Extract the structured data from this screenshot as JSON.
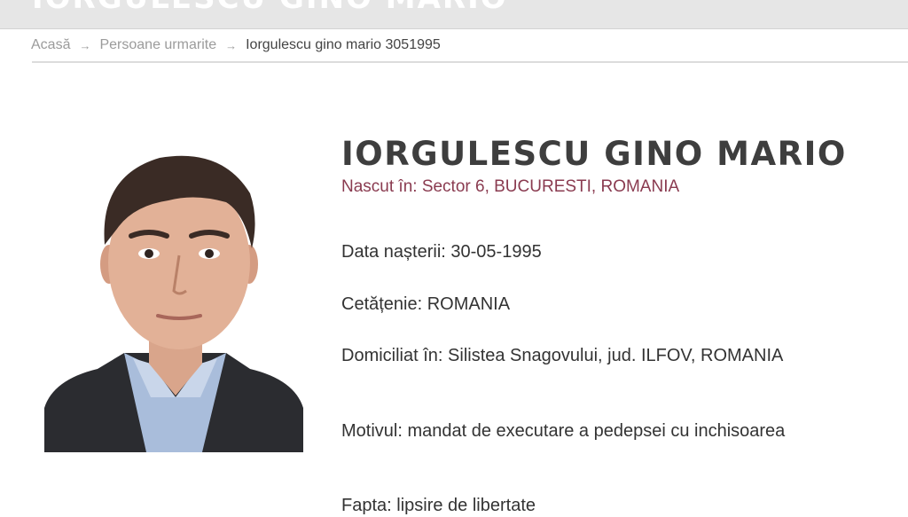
{
  "header": {
    "title": "IORGULESCU GINO MARIO"
  },
  "breadcrumb": {
    "home": "Acasă",
    "section": "Persoane urmarite",
    "current": "Iorgulescu gino mario 3051995"
  },
  "person": {
    "name": "IORGULESCU GINO MARIO",
    "birthplace": "Nascut în: Sector 6, BUCURESTI, ROMANIA",
    "birth_date": "Data nașterii: 30-05-1995",
    "citizenship": "Cetățenie: ROMANIA",
    "residence": "Domiciliat în: Silistea Snagovului, jud. ILFOV, ROMANIA",
    "reason": "Motivul: mandat de executare a pedepsei cu inchisoarea",
    "offense": "Fapta: lipsire de libertate"
  },
  "colors": {
    "accent": "#8a3b50",
    "name_text": "#3e3e3e",
    "header_bg": "#e6e6e6"
  }
}
